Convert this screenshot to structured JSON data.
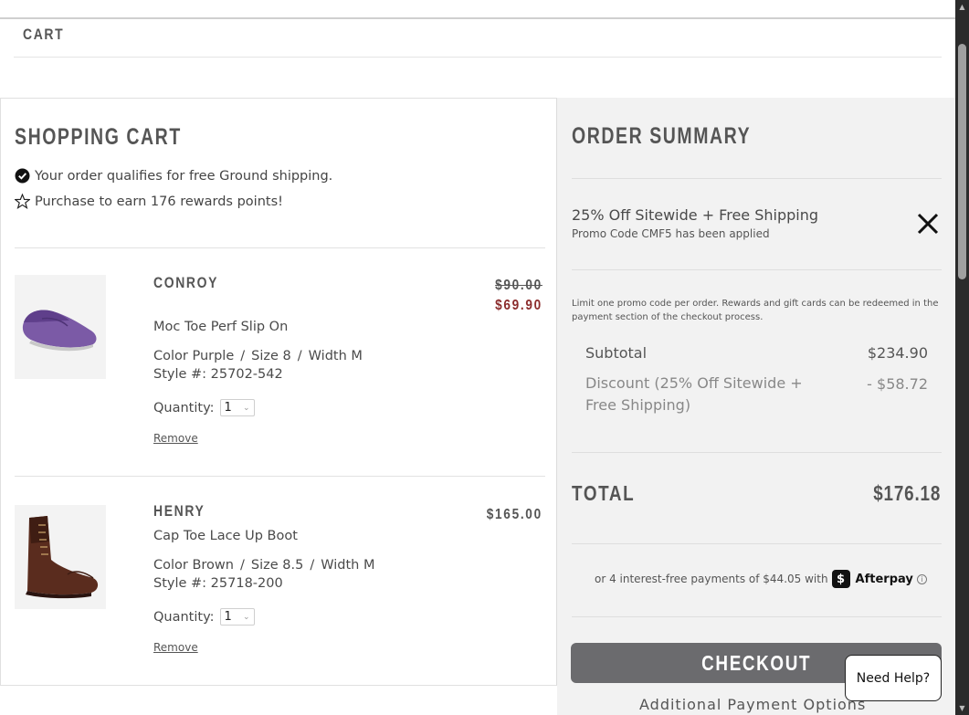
{
  "breadcrumb": "CART",
  "cart": {
    "title": "SHOPPING CART",
    "notices": [
      {
        "icon": "check-circle-icon",
        "text": "Your order qualifies for free Ground shipping."
      },
      {
        "icon": "star-outline-icon",
        "text": "Purchase to earn 176 rewards points!"
      }
    ],
    "items": [
      {
        "name": "CONROY",
        "description": "Moc Toe Perf Slip On",
        "color_label": "Color Purple",
        "size_label": "Size 8",
        "width_label": "Width M",
        "style_label": "Style #: 25702-542",
        "quantity_label": "Quantity:",
        "quantity": "1",
        "remove_label": "Remove",
        "original_price": "$90.00",
        "price": "$69.90",
        "image": "purple-loafer-image"
      },
      {
        "name": "HENRY",
        "description": "Cap Toe Lace Up Boot",
        "color_label": "Color Brown",
        "size_label": "Size 8.5",
        "width_label": "Width M",
        "style_label": "Style #: 25718-200",
        "quantity_label": "Quantity:",
        "quantity": "1",
        "remove_label": "Remove",
        "price": "$165.00",
        "image": "brown-boot-image"
      }
    ]
  },
  "summary": {
    "title": "ORDER SUMMARY",
    "promo_title": "25% Off Sitewide + Free Shipping",
    "promo_subtitle": "Promo Code CMF5 has been applied",
    "promo_note": "Limit one promo code per order. Rewards and gift cards can be redeemed in the payment section of the checkout process.",
    "subtotal_label": "Subtotal",
    "subtotal_value": "$234.90",
    "discount_label": "Discount (25% Off Sitewide + Free Shipping)",
    "discount_value": "- $58.72",
    "total_label": "TOTAL",
    "total_value": "$176.18",
    "afterpay_text": "or 4 interest-free payments of $44.05 with",
    "afterpay_brand": "Afterpay",
    "checkout_label": "CHECKOUT",
    "more_payment_label": "Additional Payment Options"
  },
  "help": {
    "label": "Need Help?"
  },
  "colors": {
    "sale_price": "#8b2c2c",
    "checkout_button": "#6b6b6e",
    "summary_bg": "#f2f2f2"
  }
}
